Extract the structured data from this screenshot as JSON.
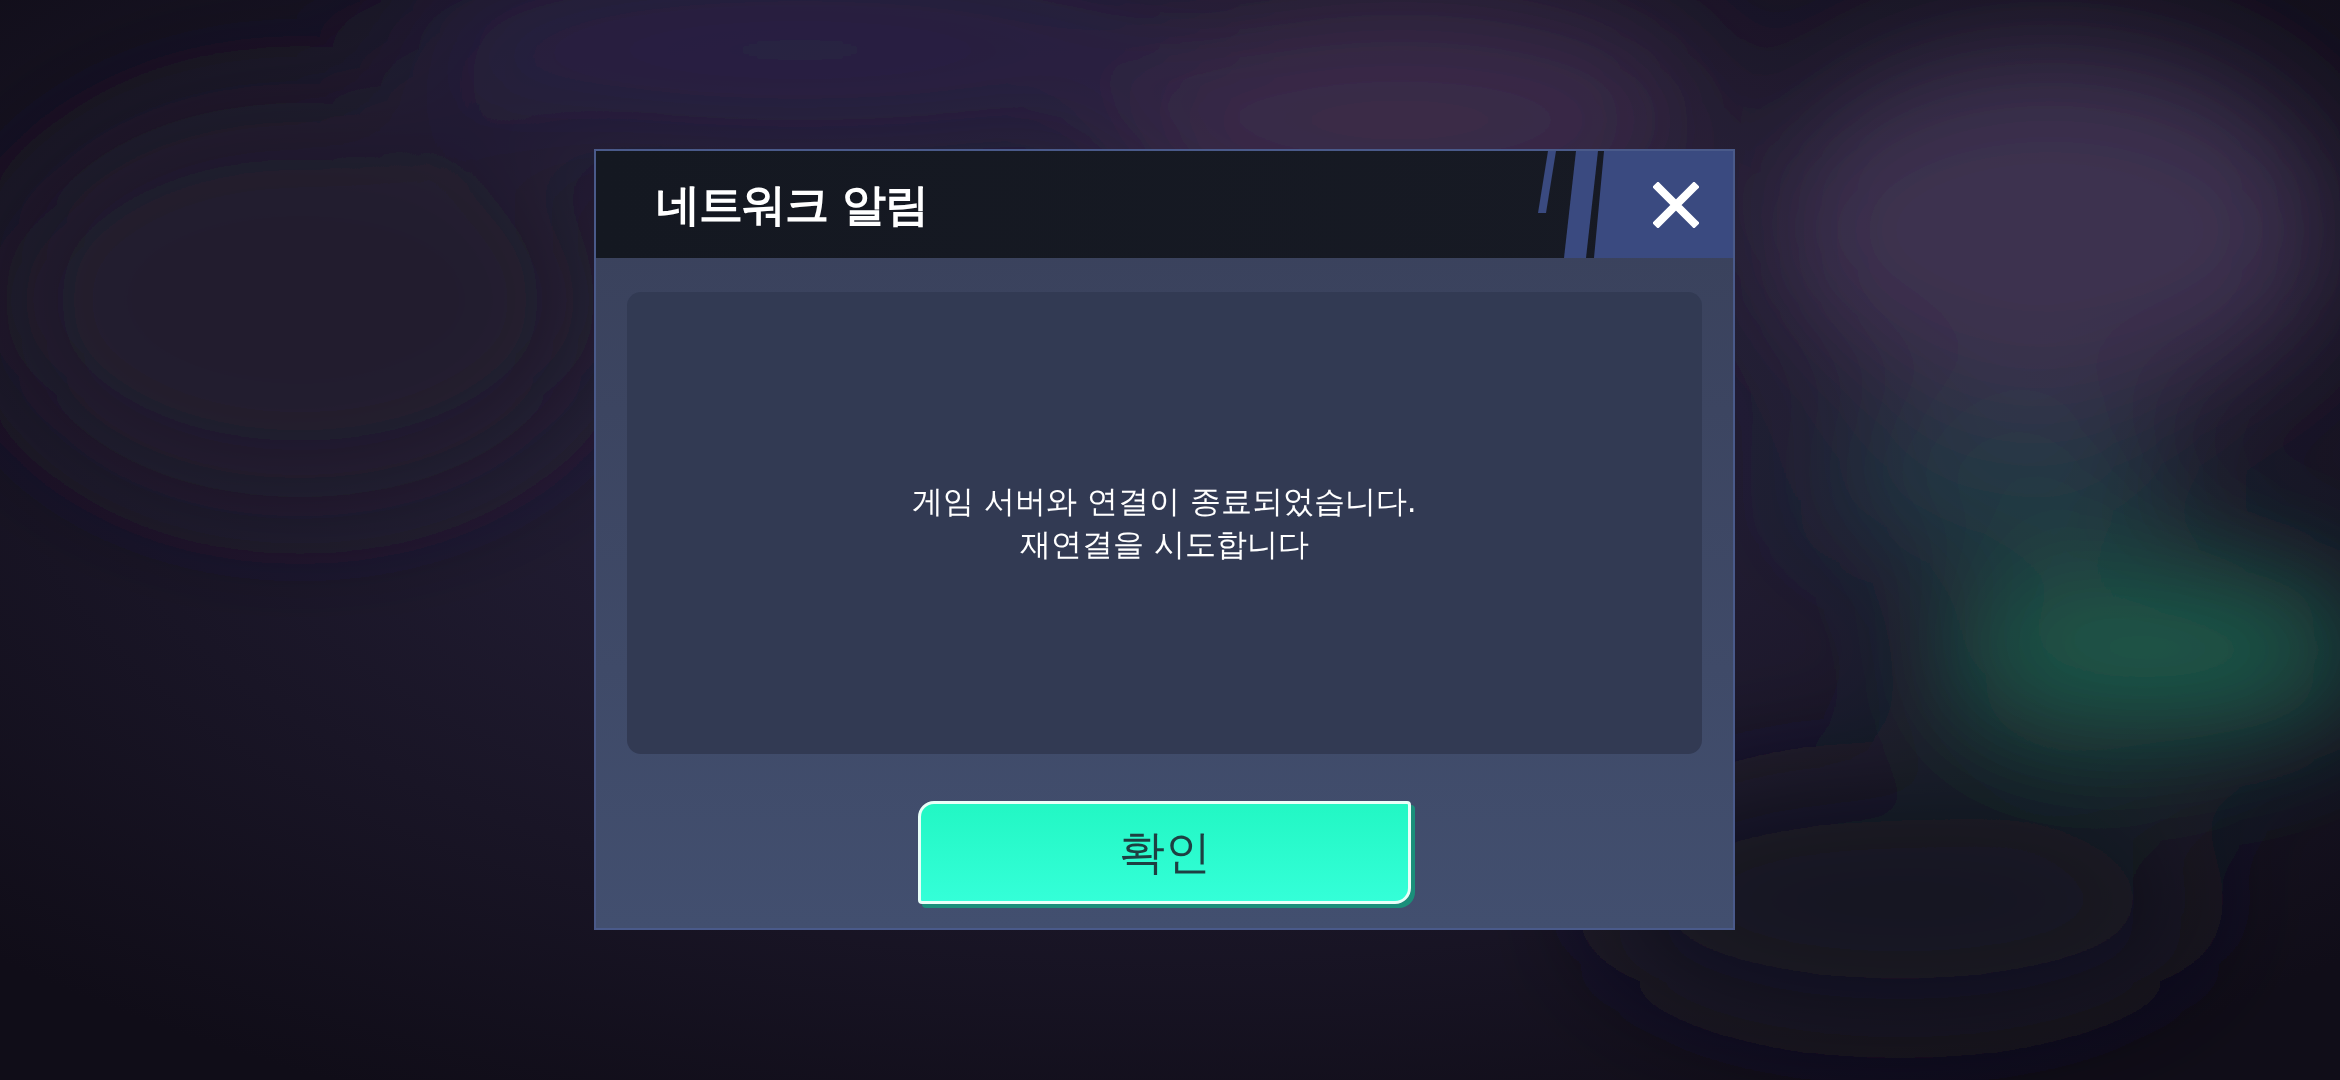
{
  "dialog": {
    "title": "네트워크 알림",
    "message_lines": [
      "게임 서버와 연결이 종료되었습니다.",
      "재연결을 시도합니다"
    ],
    "buttons": [
      {
        "label": "확인"
      }
    ]
  }
}
